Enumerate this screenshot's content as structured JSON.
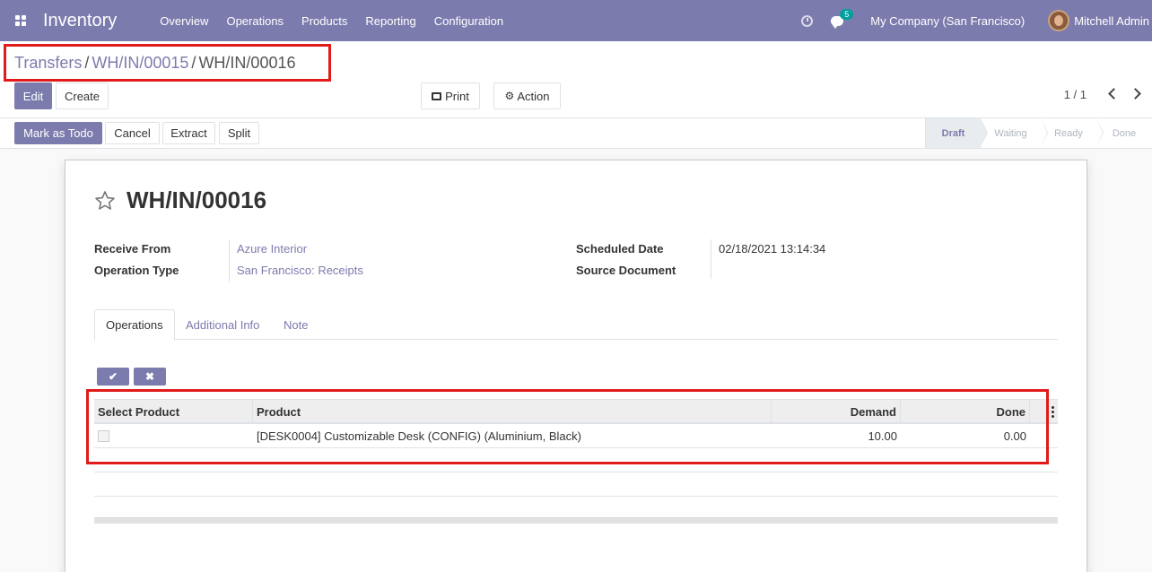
{
  "navbar": {
    "app_name": "Inventory",
    "menu": [
      "Overview",
      "Operations",
      "Products",
      "Reporting",
      "Configuration"
    ],
    "chat_badge": "5",
    "company": "My Company (San Francisco)",
    "user": "Mitchell Admin",
    "color": "#7c7bad"
  },
  "breadcrumb": {
    "items": [
      "Transfers",
      "WH/IN/00015"
    ],
    "current": "WH/IN/00016"
  },
  "toolbar": {
    "edit": "Edit",
    "create": "Create",
    "print": "Print",
    "action": "Action",
    "pager": "1 / 1"
  },
  "statusbar": {
    "buttons": [
      "Mark as Todo",
      "Cancel",
      "Extract",
      "Split"
    ],
    "steps": [
      "Draft",
      "Waiting",
      "Ready",
      "Done"
    ],
    "active_step": "Draft"
  },
  "record": {
    "title": "WH/IN/00016",
    "fields": {
      "receive_from_label": "Receive From",
      "receive_from": "Azure Interior",
      "operation_type_label": "Operation Type",
      "operation_type": "San Francisco: Receipts",
      "scheduled_date_label": "Scheduled Date",
      "scheduled_date": "02/18/2021 13:14:34",
      "source_document_label": "Source Document"
    },
    "tabs": [
      "Operations",
      "Additional Info",
      "Note"
    ],
    "active_tab": "Operations"
  },
  "table": {
    "headers": [
      "Select Product",
      "Product",
      "Demand",
      "Done"
    ],
    "rows": [
      {
        "product": "[DESK0004] Customizable Desk (CONFIG) (Aluminium, Black)",
        "demand": "10.00",
        "done": "0.00"
      }
    ]
  },
  "annotation_color": "#e11a1a"
}
